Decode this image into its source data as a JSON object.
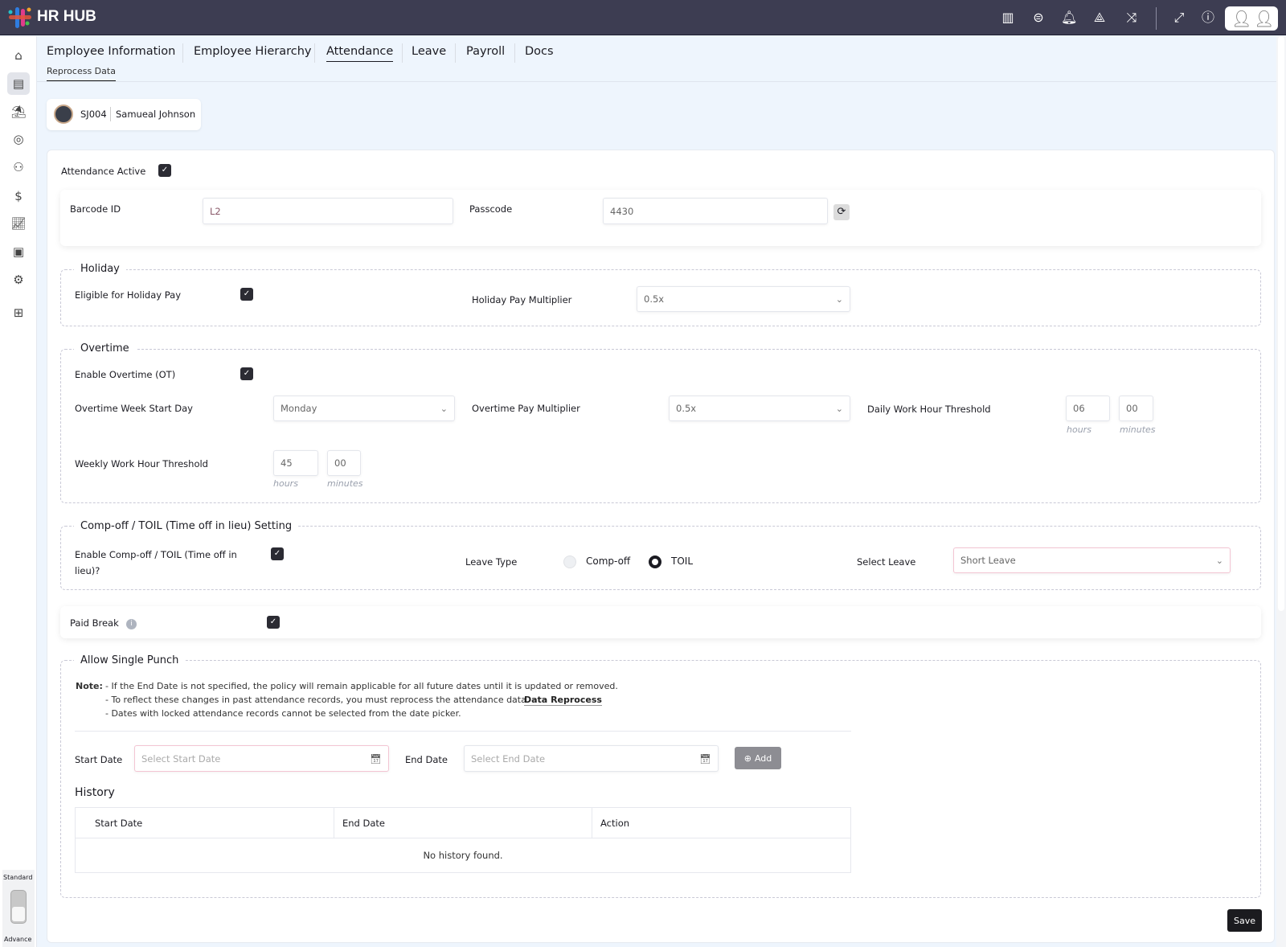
{
  "app": {
    "title": "HR HUB"
  },
  "topbar": {
    "icons": [
      "building-icon",
      "chat-icon",
      "bell-icon",
      "share-icon",
      "shuffle-icon",
      "fullscreen-icon",
      "help-icon"
    ]
  },
  "sidebar": {
    "items": [
      "home",
      "employee-card",
      "holiday",
      "fingerprint",
      "people",
      "payroll",
      "reports",
      "directory",
      "settings",
      "apps"
    ],
    "mode_top": "Standard",
    "mode_bottom": "Advance"
  },
  "tabs": [
    "Employee Information",
    "Employee Hierarchy",
    "Attendance",
    "Leave",
    "Payroll",
    "Docs"
  ],
  "subtab": "Reprocess Data",
  "employee": {
    "id": "SJ004",
    "name": "Samueal Johnson"
  },
  "form": {
    "attendance_active": "Attendance Active",
    "barcode_label": "Barcode ID",
    "barcode_value": "L2",
    "passcode_label": "Passcode",
    "passcode_value": "4430",
    "holiday": {
      "legend": "Holiday",
      "eligible": "Eligible for Holiday Pay",
      "multiplier_label": "Holiday Pay Multiplier",
      "multiplier_value": "0.5x"
    },
    "overtime": {
      "legend": "Overtime",
      "enable": "Enable Overtime (OT)",
      "week_start_label": "Overtime Week Start Day",
      "week_start_value": "Monday",
      "multiplier_label": "Overtime Pay Multiplier",
      "multiplier_value": "0.5x",
      "daily_label": "Daily Work Hour Threshold",
      "daily_hours": "06",
      "daily_minutes": "00",
      "weekly_label": "Weekly Work Hour Threshold",
      "weekly_hours": "45",
      "weekly_minutes": "00",
      "hours": "hours",
      "minutes": "minutes"
    },
    "compoff": {
      "legend": "Comp-off / TOIL (Time off in lieu) Setting",
      "enable_1": "Enable Comp-off / TOIL (Time off in",
      "enable_2": "lieu)?",
      "leave_type": "Leave Type",
      "opt1": "Comp-off",
      "opt2": "TOIL",
      "selected": "TOIL",
      "select_leave": "Select Leave",
      "select_leave_value": "Short Leave"
    },
    "paid_break": "Paid Break",
    "single_punch": {
      "legend": "Allow Single Punch",
      "note_label": "Note:",
      "note_1": "- If the End Date is not specified, the policy will remain applicable for all future dates until it is updated or removed.",
      "note_2": "- To reflect these changes in past attendance records, you must reprocess the attendance data.",
      "note_link": "Data Reprocess",
      "note_3": "- Dates with locked attendance records cannot be selected from the date picker.",
      "start_label": "Start Date",
      "start_placeholder": "Select Start Date",
      "end_label": "End Date",
      "end_placeholder": "Select End Date",
      "add": "Add",
      "history": "History",
      "columns": [
        "Start Date",
        "End Date",
        "Action"
      ],
      "empty": "No history found."
    },
    "save": "Save"
  }
}
